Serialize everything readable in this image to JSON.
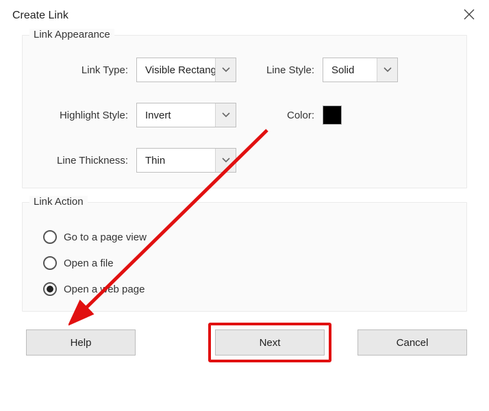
{
  "dialog": {
    "title": "Create Link"
  },
  "appearance": {
    "legend": "Link Appearance",
    "link_type_label": "Link Type:",
    "link_type_value": "Visible Rectangle",
    "line_style_label": "Line Style:",
    "line_style_value": "Solid",
    "highlight_style_label": "Highlight Style:",
    "highlight_style_value": "Invert",
    "color_label": "Color:",
    "color_value": "#000000",
    "line_thickness_label": "Line Thickness:",
    "line_thickness_value": "Thin"
  },
  "action": {
    "legend": "Link Action",
    "options": [
      {
        "label": "Go to a page view",
        "selected": false
      },
      {
        "label": "Open a file",
        "selected": false
      },
      {
        "label": "Open a web page",
        "selected": true
      }
    ]
  },
  "buttons": {
    "help": "Help",
    "next": "Next",
    "cancel": "Cancel"
  },
  "annotations": {
    "highlight_target": "next",
    "arrow_color": "#e11010"
  }
}
